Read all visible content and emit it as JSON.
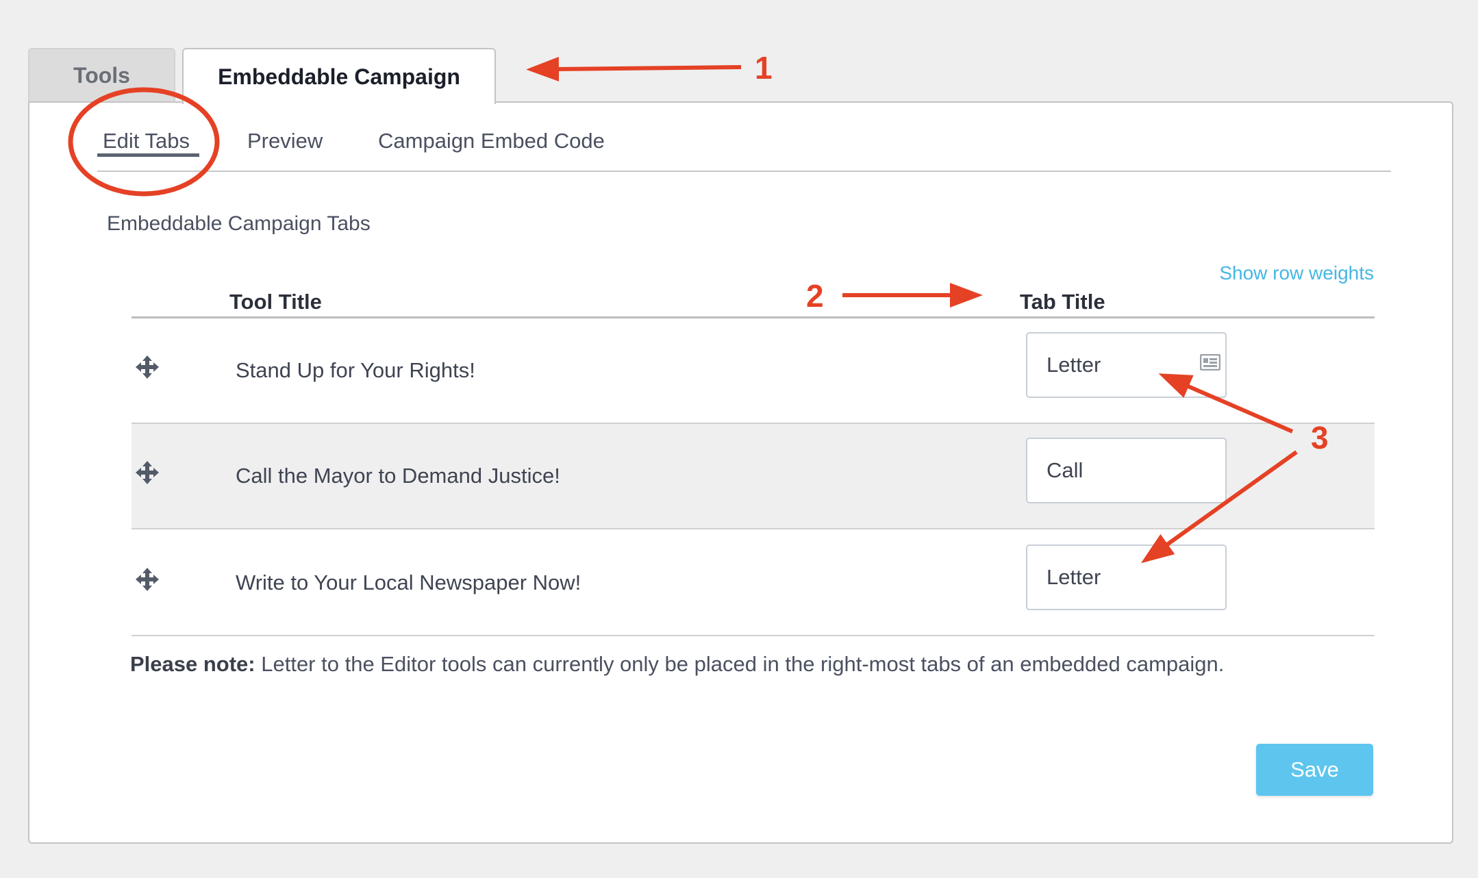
{
  "top_tabs": [
    {
      "label": "Tools",
      "active": false
    },
    {
      "label": "Embeddable Campaign",
      "active": true
    }
  ],
  "sub_tabs": [
    {
      "label": "Edit Tabs",
      "active": true
    },
    {
      "label": "Preview",
      "active": false
    },
    {
      "label": "Campaign Embed Code",
      "active": false
    }
  ],
  "section_title": "Embeddable Campaign Tabs",
  "show_row_weights": "Show row weights",
  "table": {
    "headers": {
      "tool_title": "Tool Title",
      "tab_title": "Tab Title"
    },
    "rows": [
      {
        "tool_title": "Stand Up for Your Rights!",
        "tab_title": "Letter"
      },
      {
        "tool_title": "Call the Mayor to Demand Justice!",
        "tab_title": "Call"
      },
      {
        "tool_title": "Write to Your Local Newspaper Now!",
        "tab_title": "Letter"
      }
    ]
  },
  "note": {
    "label": "Please note:",
    "text": " Letter to the Editor tools can currently only be placed in the right-most tabs of an embedded campaign."
  },
  "save_label": "Save",
  "annotations": {
    "callout_1": "1",
    "callout_2": "2",
    "callout_3": "3"
  },
  "colors": {
    "accent": "#45b7e3",
    "save_button": "#5ec6ee",
    "annotation": "#e54125"
  }
}
